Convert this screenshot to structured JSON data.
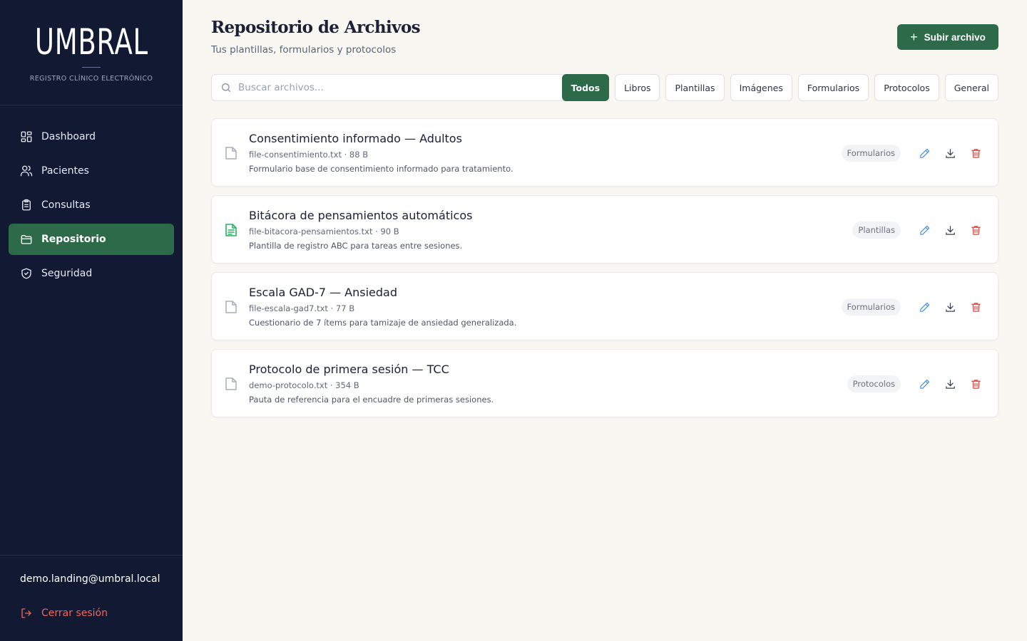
{
  "brand": {
    "name": "UMBRAL",
    "subtitle": "REGISTRO CLÍNICO ELECTRÓNICO"
  },
  "sidebar": {
    "items": [
      {
        "label": "Dashboard",
        "icon": "dashboard-icon",
        "active": false
      },
      {
        "label": "Pacientes",
        "icon": "users-icon",
        "active": false
      },
      {
        "label": "Consultas",
        "icon": "clipboard-icon",
        "active": false
      },
      {
        "label": "Repositorio",
        "icon": "folder-icon",
        "active": true
      },
      {
        "label": "Seguridad",
        "icon": "shield-icon",
        "active": false
      }
    ],
    "user_email": "demo.landing@umbral.local",
    "logout_label": "Cerrar sesión"
  },
  "header": {
    "title": "Repositorio de Archivos",
    "subtitle": "Tus plantillas, formularios y protocolos",
    "upload_label": "Subir archivo"
  },
  "search": {
    "placeholder": "Buscar archivos...",
    "value": ""
  },
  "filters": [
    {
      "label": "Todos",
      "active": true
    },
    {
      "label": "Libros",
      "active": false
    },
    {
      "label": "Plantillas",
      "active": false
    },
    {
      "label": "Imágenes",
      "active": false
    },
    {
      "label": "Formularios",
      "active": false
    },
    {
      "label": "Protocolos",
      "active": false
    },
    {
      "label": "General",
      "active": false
    }
  ],
  "files": [
    {
      "title": "Consentimiento informado — Adultos",
      "meta": "file-consentimiento.txt · 88 B",
      "description": "Formulario base de consentimiento informado para tratamiento.",
      "category": "Formularios",
      "icon": "file-icon"
    },
    {
      "title": "Bitácora de pensamientos automáticos",
      "meta": "file-bitacora-pensamientos.txt · 90 B",
      "description": "Plantilla de registro ABC para tareas entre sesiones.",
      "category": "Plantillas",
      "icon": "file-text-icon"
    },
    {
      "title": "Escala GAD-7 — Ansiedad",
      "meta": "file-escala-gad7.txt · 77 B",
      "description": "Cuestionario de 7 ítems para tamizaje de ansiedad generalizada.",
      "category": "Formularios",
      "icon": "file-icon"
    },
    {
      "title": "Protocolo de primera sesión — TCC",
      "meta": "demo-protocolo.txt · 354 B",
      "description": "Pauta de referencia para el encuadre de primeras sesiones.",
      "category": "Protocolos",
      "icon": "file-icon"
    }
  ],
  "colors": {
    "sidebar_bg": "#121a33",
    "accent": "#2d6a4a",
    "danger": "#e0443e",
    "edit": "#4a8ed6",
    "background": "#f8f7f1"
  }
}
